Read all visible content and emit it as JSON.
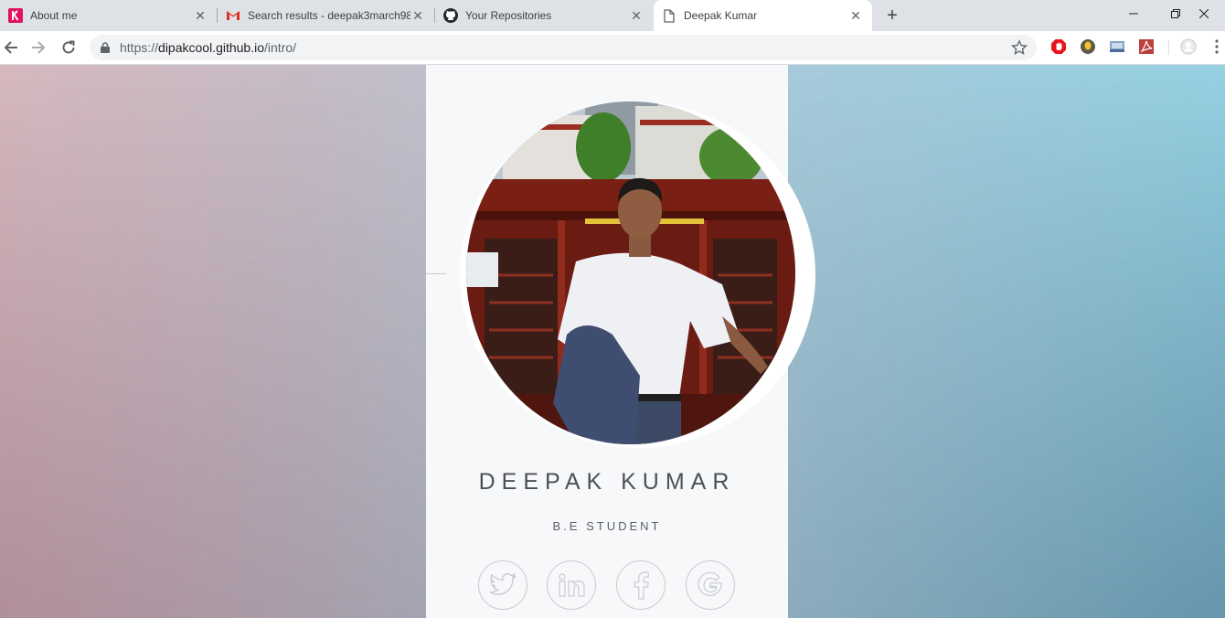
{
  "browser": {
    "tabs": [
      {
        "title": "About me",
        "icon": "k-logo-icon",
        "active": false
      },
      {
        "title": "Search results - deepak3march98",
        "icon": "gmail-icon",
        "active": false
      },
      {
        "title": "Your Repositories",
        "icon": "github-icon",
        "active": false
      },
      {
        "title": "Deepak Kumar",
        "icon": "page-icon",
        "active": true
      }
    ],
    "url": {
      "scheme": "https://",
      "host": "dipakcool.github.io",
      "path": "/intro/"
    },
    "window_controls": [
      "minimize",
      "restore",
      "close"
    ]
  },
  "profile": {
    "name": "DEEPAK KUMAR",
    "role": "B.E STUDENT",
    "photo": "profile-photo",
    "social": [
      {
        "name": "twitter",
        "icon": "twitter-icon"
      },
      {
        "name": "linkedin",
        "icon": "linkedin-icon"
      },
      {
        "name": "facebook",
        "icon": "facebook-icon"
      },
      {
        "name": "google",
        "icon": "google-icon"
      }
    ]
  },
  "colors": {
    "tab_strip": "#dee1e6",
    "card": "#f7f8f9",
    "text": "#4d5054"
  }
}
